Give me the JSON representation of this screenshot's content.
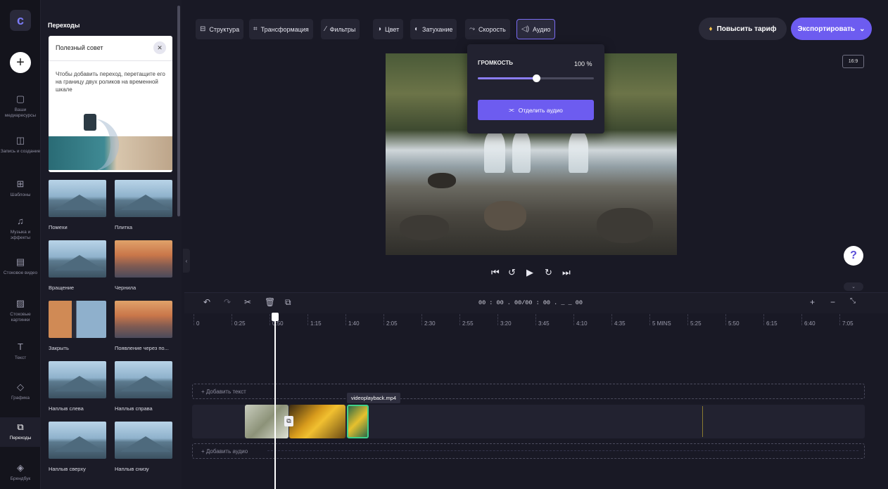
{
  "rail": {
    "logo": "c",
    "items": [
      {
        "label": "Ваши медиаресурсы",
        "icon": "folder-icon"
      },
      {
        "label": "Запись и создание",
        "icon": "camera-icon"
      },
      {
        "label": "Шаблоны",
        "icon": "grid-icon"
      },
      {
        "label": "Музыка и эффекты",
        "icon": "music-icon"
      },
      {
        "label": "Стоковое видео",
        "icon": "film-icon"
      },
      {
        "label": "Стоковые картинки",
        "icon": "image-icon"
      },
      {
        "label": "Текст",
        "icon": "text-icon"
      },
      {
        "label": "Графика",
        "icon": "shapes-icon"
      },
      {
        "label": "Переходы",
        "icon": "transition-icon"
      },
      {
        "label": "Брендбук",
        "icon": "brand-icon"
      }
    ]
  },
  "panel": {
    "title": "Переходы",
    "tip": {
      "title": "Полезный совет",
      "text": "Чтобы добавить переход, перетащите его на границу двух роликов на временной шкале"
    },
    "transitions": [
      "Помехи",
      "Плитка",
      "Вращение",
      "Чернила",
      "Закрыть",
      "Появление через по...",
      "Наплыв слева",
      "Наплыв справа",
      "Наплыв сверху",
      "Наплыв снизу"
    ]
  },
  "toolbar": {
    "structure": "Структура",
    "transform": "Трансформация",
    "filters": "Фильтры",
    "color": "Цвет",
    "fade": "Затухание",
    "speed": "Скорость",
    "audio": "Аудио",
    "upgrade": "Повысить тариф",
    "export": "Экспортировать"
  },
  "preview": {
    "aspect_ratio": "16:9"
  },
  "audio_popover": {
    "volume_label": "ГРОМКОСТЬ",
    "volume_value": "100 %",
    "volume_fraction": 0.5,
    "detach_button": "Отделить аудио"
  },
  "timeline": {
    "timecode": "00 : 00 . 00/00 : 00 . _ _ 00",
    "ticks": [
      "0",
      "0:25",
      "0:50",
      "1:15",
      "1:40",
      "2:05",
      "2:30",
      "2:55",
      "3:20",
      "3:45",
      "4:10",
      "4:35",
      "5 MINS",
      "5:25",
      "5:50",
      "6:15",
      "6:40",
      "7:05"
    ],
    "add_text": "+ Добавить текст",
    "add_audio": "+ Добавить аудио",
    "clip_name": "videoplayback.mp4"
  }
}
